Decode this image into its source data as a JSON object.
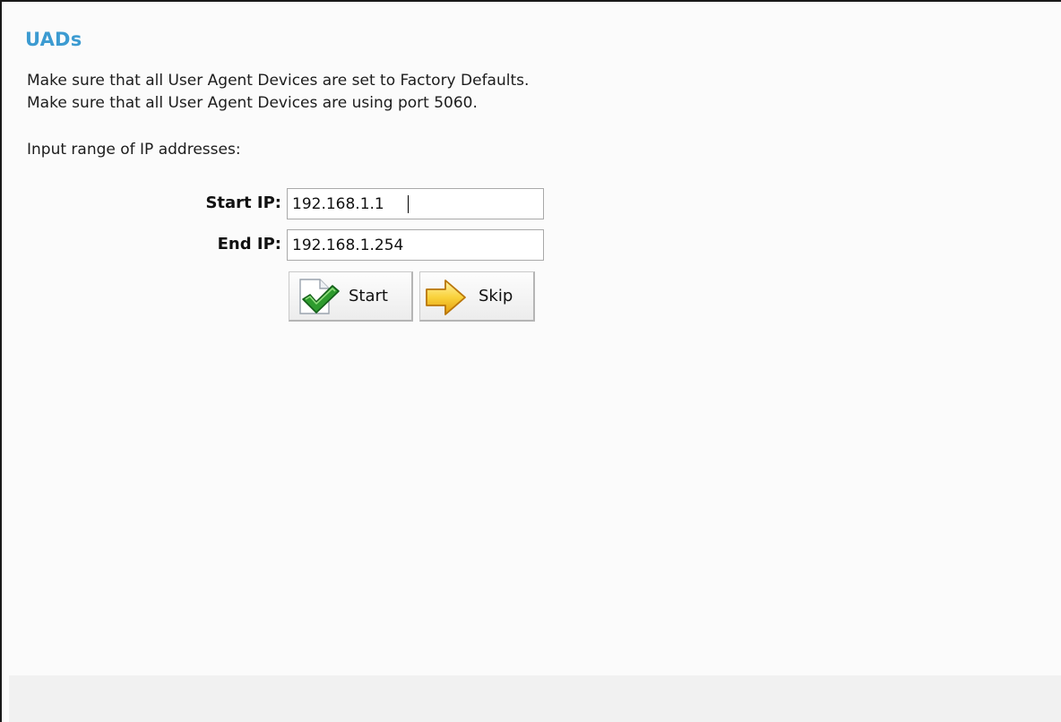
{
  "page": {
    "title": "UADs",
    "message_1": "Make sure that all User Agent Devices are set to Factory Defaults.",
    "message_2": "Make sure that all User Agent Devices are using port 5060.",
    "prompt": "Input range of IP addresses:"
  },
  "form": {
    "start_label": "Start IP:",
    "start_value": "192.168.1.1",
    "end_label": "End IP:",
    "end_value": "192.168.1.254"
  },
  "buttons": {
    "start_label": "Start",
    "start_icon": "checkmark-icon",
    "skip_label": "Skip",
    "skip_icon": "arrow-right-icon"
  },
  "colors": {
    "title": "#3c9bd1",
    "check_green": "#2e9b2e",
    "arrow_yellow": "#f6c21a"
  }
}
